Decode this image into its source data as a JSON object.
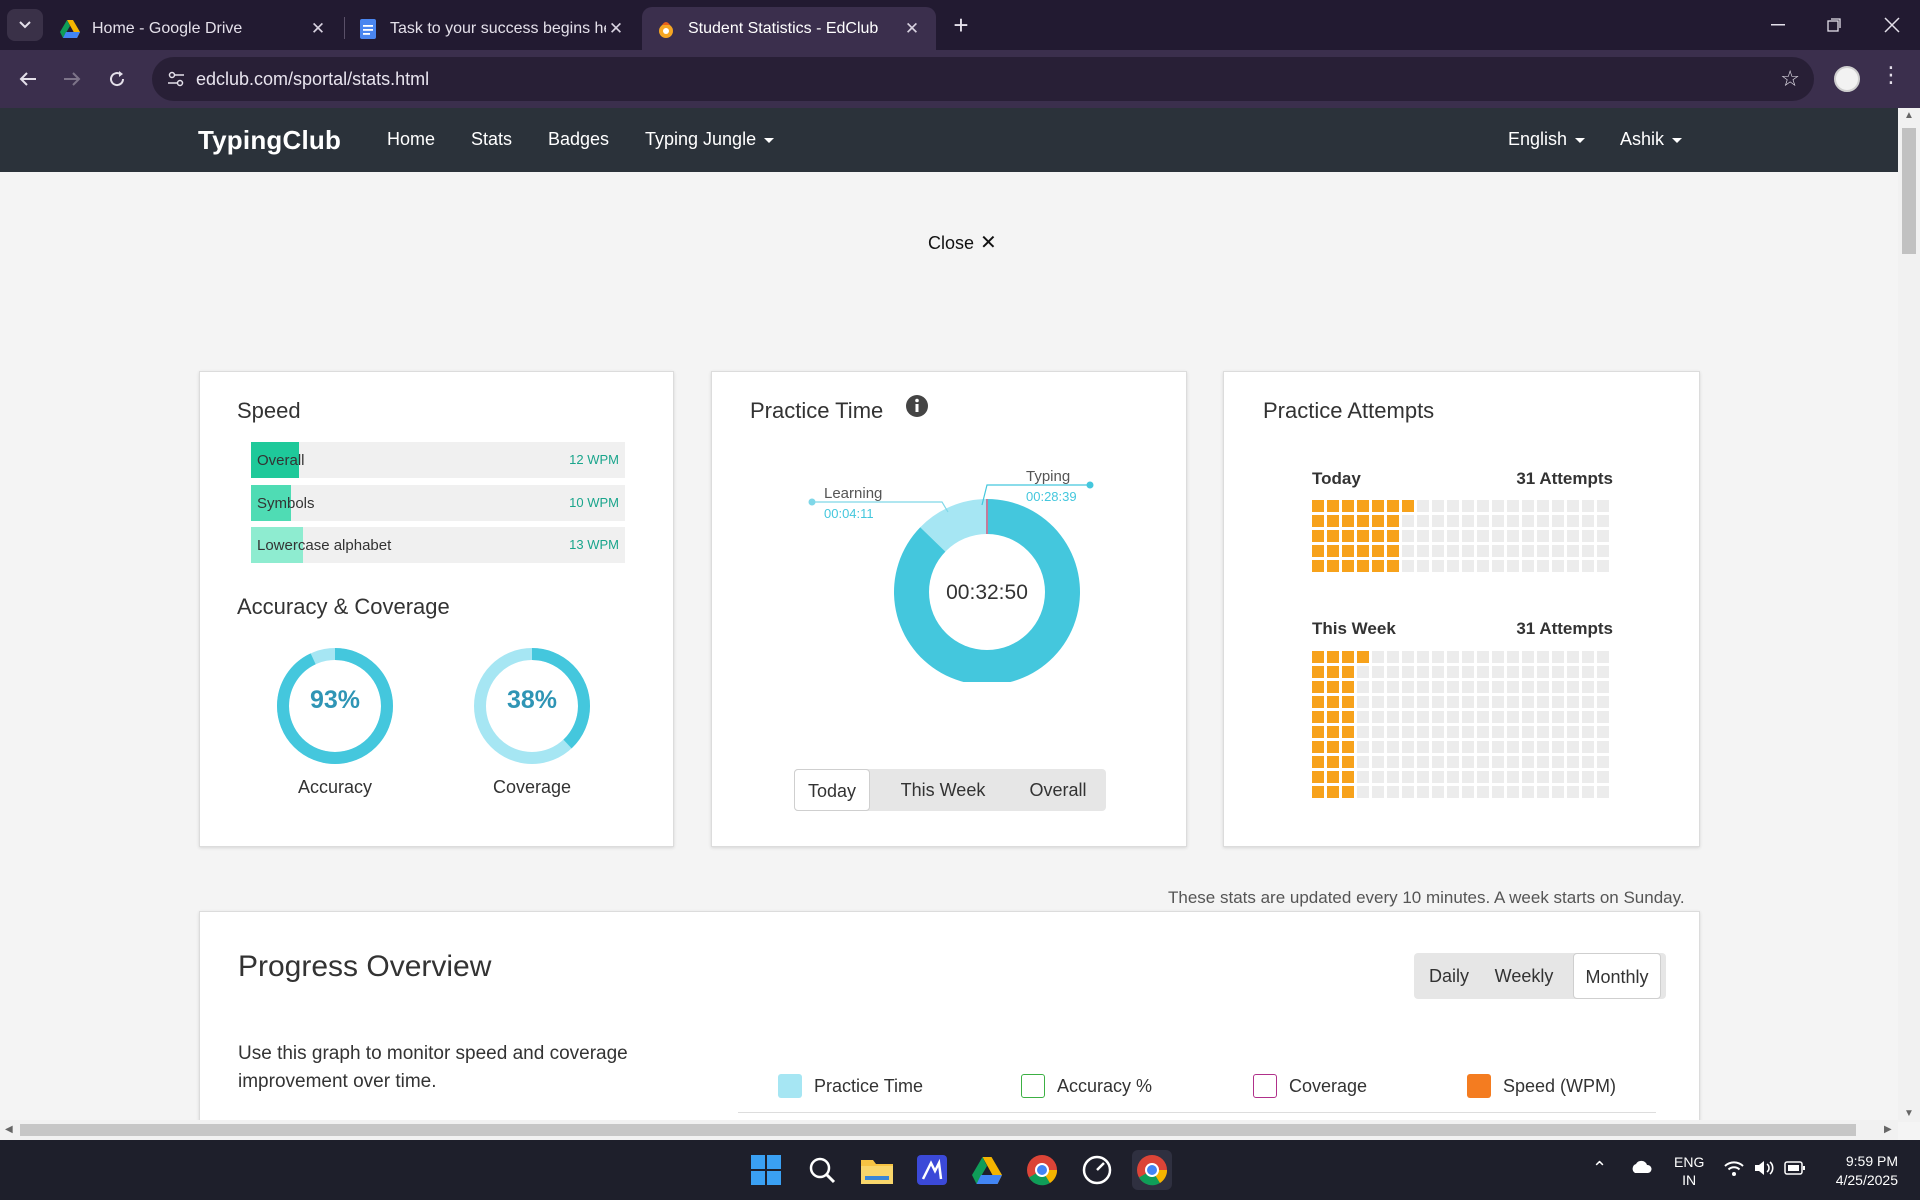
{
  "browser": {
    "tabs": [
      {
        "title": "Home - Google Drive",
        "icon": "google-drive-icon"
      },
      {
        "title": "Task to your success begins here",
        "icon": "google-docs-icon"
      },
      {
        "title": "Student Statistics - EdClub",
        "icon": "edclub-icon",
        "active": true
      }
    ],
    "url": "edclub.com/sportal/stats.html"
  },
  "nav": {
    "brand": "TypingClub",
    "links": [
      "Home",
      "Stats",
      "Badges",
      "Typing Jungle"
    ],
    "language": "English",
    "user": "Ashik"
  },
  "close_label": "Close",
  "speed": {
    "title": "Speed",
    "rows": [
      {
        "label": "Overall",
        "value": "12 WPM",
        "color": "#1ec99a"
      },
      {
        "label": "Symbols",
        "value": "10 WPM",
        "color": "#4fdcb4"
      },
      {
        "label": "Lowercase alphabet",
        "value": "13 WPM",
        "color": "#8eecd0"
      }
    ]
  },
  "accuracy": {
    "title": "Accuracy & Coverage",
    "accuracy_value": "93%",
    "accuracy_label": "Accuracy",
    "accuracy_fraction": 0.93,
    "coverage_value": "38%",
    "coverage_label": "Coverage",
    "coverage_fraction": 0.38
  },
  "practice_time": {
    "title": "Practice Time",
    "total": "00:32:50",
    "learning_label": "Learning",
    "learning_time": "00:04:11",
    "typing_label": "Typing",
    "typing_time": "00:28:39",
    "tabs": [
      "Today",
      "This Week",
      "Overall"
    ],
    "selected_tab": "Today"
  },
  "chart_data": {
    "type": "pie",
    "categories": [
      "Learning",
      "Typing"
    ],
    "values": [
      251,
      1719
    ],
    "colors": [
      "#a6e6f3",
      "#44c7dd"
    ]
  },
  "attempts": {
    "title": "Practice Attempts",
    "today_label": "Today",
    "today_count": "31 Attempts",
    "today_attempts": 31,
    "week_label": "This Week",
    "week_count": "31 Attempts",
    "week_attempts": 31
  },
  "note": "These stats are updated every 10 minutes. A week starts on Sunday.",
  "progress": {
    "title": "Progress Overview",
    "description": "Use this graph to monitor speed and coverage improvement over time.",
    "tabs": [
      "Daily",
      "Weekly",
      "Monthly"
    ],
    "selected_tab": "Monthly",
    "legend": [
      {
        "label": "Practice Time",
        "color": "#a6e6f3"
      },
      {
        "label": "Accuracy %",
        "color": "#3cb043"
      },
      {
        "label": "Coverage",
        "color": "#b0308a"
      },
      {
        "label": "Speed (WPM)",
        "color": "#f47c20"
      }
    ]
  },
  "taskbar": {
    "lang_top": "ENG",
    "lang_bottom": "IN",
    "time": "9:59 PM",
    "date": "4/25/2025"
  }
}
